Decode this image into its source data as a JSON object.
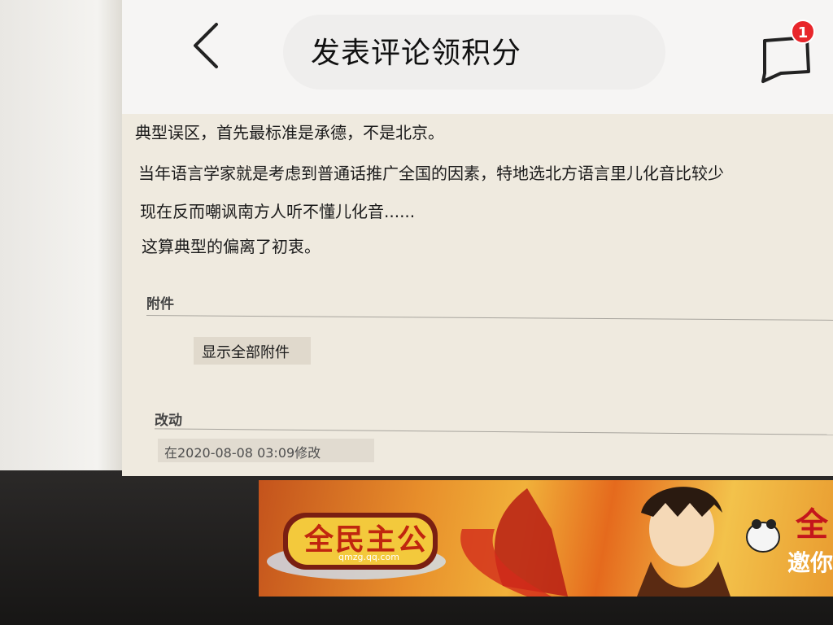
{
  "header": {
    "title": "发表评论领积分",
    "notification_count": "1",
    "back_icon": "chevron-left-icon",
    "message_icon": "chat-bubble-icon"
  },
  "post": {
    "lines": [
      "典型误区，首先最标准是承德，不是北京。",
      "当年语言学家就是考虑到普通话推广全国的因素，特地选北方语言里儿化音比较少",
      "现在反而嘲讽南方人听不懂儿化音......",
      "这算典型的偏离了初衷。"
    ]
  },
  "attachments": {
    "label": "附件",
    "show_all_button": "显示全部附件"
  },
  "changes": {
    "label": "改动",
    "modified_text": "在2020-08-08 03:09修改"
  },
  "ad": {
    "logo_text": "全民主公",
    "logo_url_text": "qmzg.qq.com",
    "side_text_top": "全",
    "side_text_bottom": "邀你"
  },
  "colors": {
    "badge": "#e8262b",
    "screen_bg": "#efeadf",
    "topbar_bg": "#f6f5f4",
    "ad_orange": "#e88f2b"
  }
}
